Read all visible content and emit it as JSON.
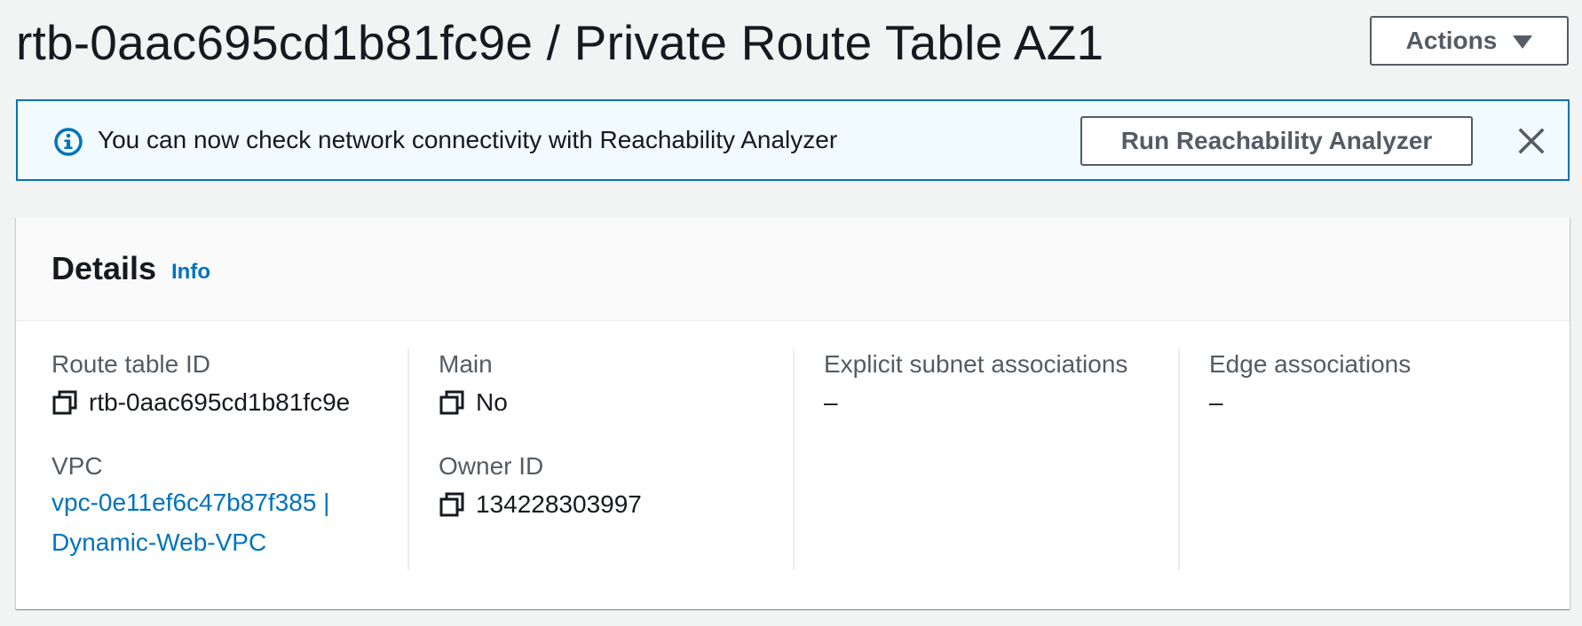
{
  "header": {
    "title": "rtb-0aac695cd1b81fc9e / Private Route Table AZ1",
    "actions_label": "Actions"
  },
  "flash": {
    "message": "You can now check network connectivity with Reachability Analyzer",
    "button_label": "Run Reachability Analyzer",
    "icon": "info-circle-icon",
    "close_icon": "close-icon"
  },
  "details": {
    "title": "Details",
    "info_label": "Info",
    "route_table_id": {
      "label": "Route table ID",
      "value": "rtb-0aac695cd1b81fc9e"
    },
    "vpc": {
      "label": "VPC",
      "link_line1": "vpc-0e11ef6c47b87f385 |",
      "link_line2": "Dynamic-Web-VPC"
    },
    "main": {
      "label": "Main",
      "value": "No"
    },
    "owner_id": {
      "label": "Owner ID",
      "value": "134228303997"
    },
    "explicit_subnet_associations": {
      "label": "Explicit subnet associations",
      "value": "–"
    },
    "edge_associations": {
      "label": "Edge associations",
      "value": "–"
    }
  },
  "colors": {
    "background": "#f2f3f3",
    "link": "#0073bb",
    "banner_border": "#0073bb",
    "banner_background": "#f1faff",
    "text": "#16191f",
    "label": "#545b64"
  }
}
